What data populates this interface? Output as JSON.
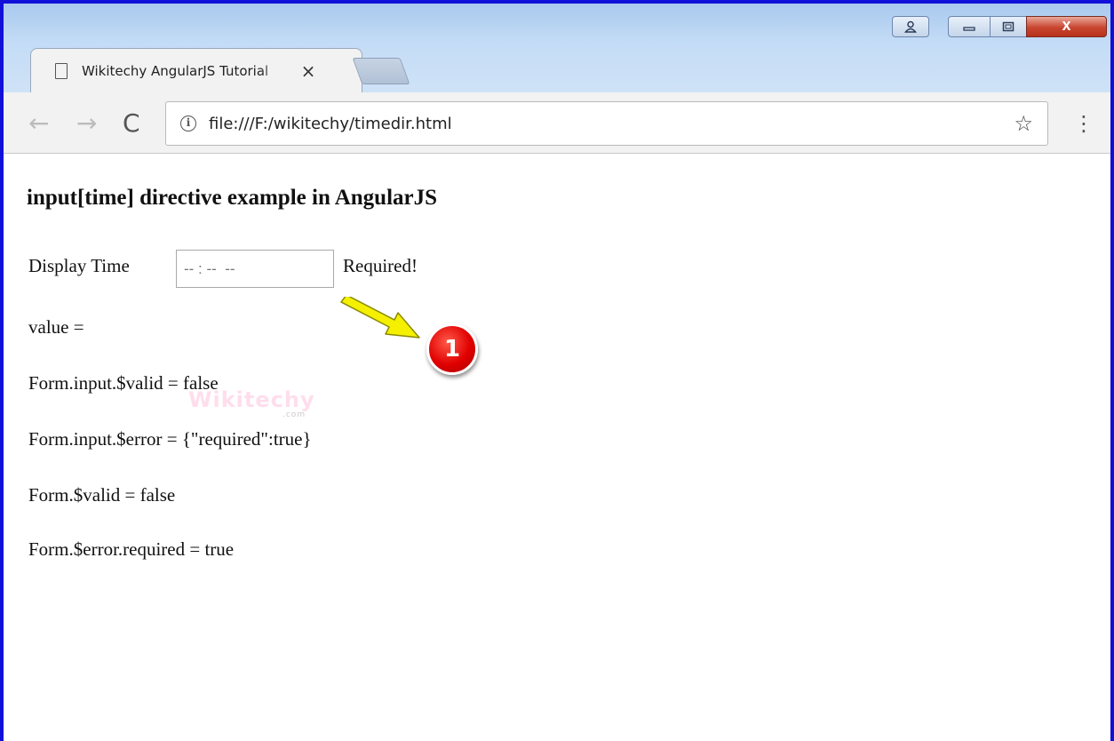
{
  "window": {
    "close_label": "X"
  },
  "tab": {
    "title": "Wikitechy AngularJS Tutorial",
    "close": "×"
  },
  "toolbar": {
    "back_icon": "←",
    "forward_icon": "→",
    "reload_icon": "C",
    "url": "file:///F:/wikitechy/timedir.html",
    "star_icon": "☆",
    "menu_icon": "⋮"
  },
  "page": {
    "heading": "input[time] directive example in AngularJS",
    "display_time_label": "Display Time",
    "time_placeholder": "-- : --  --",
    "required_text": "Required!",
    "value_line": "value =",
    "input_valid_line": "Form.input.$valid = false",
    "input_error_line": "Form.input.$error = {\"required\":true}",
    "form_valid_line": "Form.$valid = false",
    "form_error_line": "Form.$error.required = true"
  },
  "watermark": {
    "brand": "Wikitechy",
    "suffix": ".com"
  },
  "annotation": {
    "badge": "1"
  },
  "colors": {
    "frame_border": "#1010d8",
    "badge": "#e00000",
    "arrow": "#f5f000"
  }
}
